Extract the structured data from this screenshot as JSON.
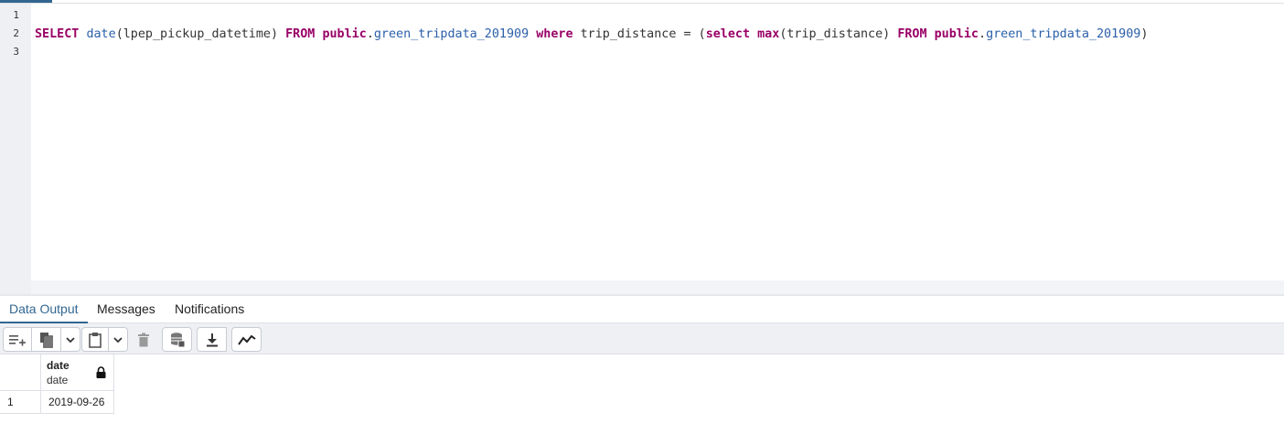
{
  "editor": {
    "line_numbers": [
      "1",
      "2",
      "3"
    ],
    "query_tokens": [
      {
        "t": "SELECT",
        "c": "kw"
      },
      {
        "t": " ",
        "c": "plain"
      },
      {
        "t": "date",
        "c": "ident"
      },
      {
        "t": "(lpep_pickup_datetime) ",
        "c": "plain"
      },
      {
        "t": "FROM",
        "c": "kw"
      },
      {
        "t": " ",
        "c": "plain"
      },
      {
        "t": "public",
        "c": "kw"
      },
      {
        "t": ".",
        "c": "plain"
      },
      {
        "t": "green_tripdata_201909",
        "c": "ident"
      },
      {
        "t": " ",
        "c": "plain"
      },
      {
        "t": "where",
        "c": "kw"
      },
      {
        "t": " trip_distance = (",
        "c": "plain"
      },
      {
        "t": "select",
        "c": "kw"
      },
      {
        "t": " ",
        "c": "plain"
      },
      {
        "t": "max",
        "c": "kw"
      },
      {
        "t": "(trip_distance) ",
        "c": "plain"
      },
      {
        "t": "FROM",
        "c": "kw"
      },
      {
        "t": " ",
        "c": "plain"
      },
      {
        "t": "public",
        "c": "kw"
      },
      {
        "t": ".",
        "c": "plain"
      },
      {
        "t": "green_tripdata_201909",
        "c": "ident"
      },
      {
        "t": ")",
        "c": "plain"
      }
    ]
  },
  "tabs": {
    "data_output": "Data Output",
    "messages": "Messages",
    "notifications": "Notifications",
    "active": "data_output"
  },
  "toolbar": {
    "icons": [
      "add-row-icon",
      "copy-icon",
      "copy-options-chevron-icon",
      "paste-icon",
      "paste-options-chevron-icon",
      "delete-icon",
      "save-data-icon",
      "download-icon",
      "graph-icon"
    ]
  },
  "result": {
    "column": {
      "name": "date",
      "type": "date",
      "locked_icon": "lock-icon"
    },
    "rows": [
      {
        "num": "1",
        "value": "2019-09-26"
      }
    ]
  },
  "colors": {
    "keyword": "#990066",
    "identifier": "#2a5fa8",
    "accent": "#326690"
  }
}
